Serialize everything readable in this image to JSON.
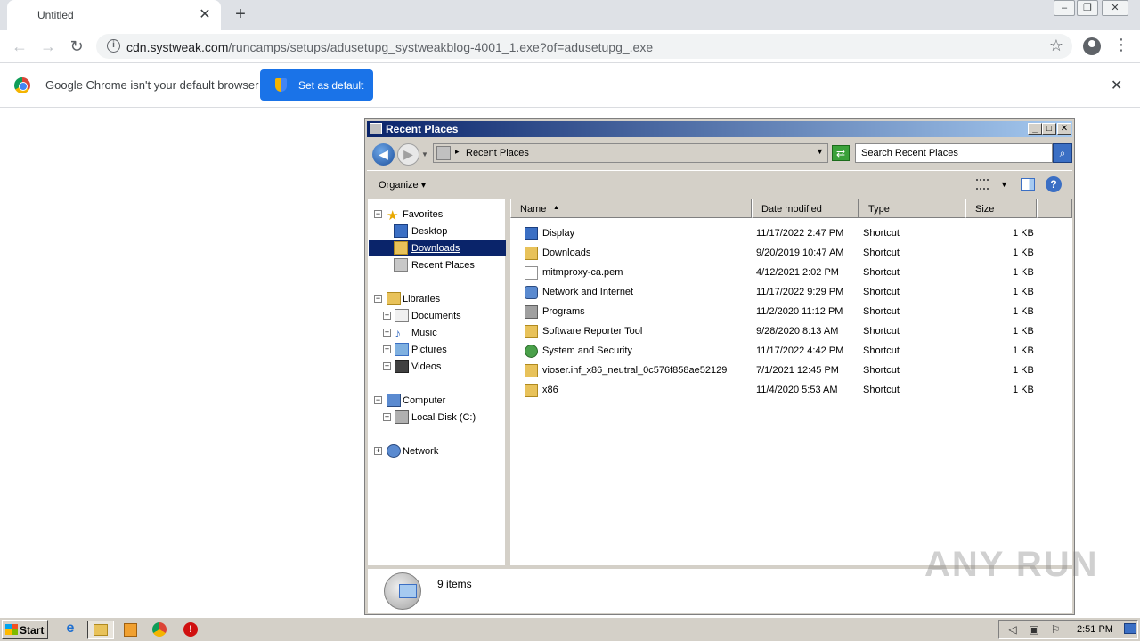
{
  "browser": {
    "tab_title": "Untitled",
    "tab_close": "✕",
    "new_tab": "+",
    "url_host": "cdn.systweak.com",
    "url_path": "/runcamps/setups/adusetupg_systweakblog-4001_1.exe?of=adusetupg_.exe",
    "info_text": "Google Chrome isn't your default browser",
    "set_default_label": "Set as default",
    "info_close": "✕",
    "back": "←",
    "forward": "→",
    "reload": "↻",
    "star": "☆",
    "menu": "⋮",
    "info_icon": "i"
  },
  "explorer": {
    "title": "Recent Places",
    "address_text": "Recent Places",
    "search_placeholder": "Search Recent Places",
    "organize_label": "Organize",
    "nav": {
      "favorites": "Favorites",
      "desktop": "Desktop",
      "downloads": "Downloads",
      "recent_places": "Recent Places",
      "libraries": "Libraries",
      "documents": "Documents",
      "music": "Music",
      "pictures": "Pictures",
      "videos": "Videos",
      "computer": "Computer",
      "local_disk": "Local Disk (C:)",
      "network": "Network"
    },
    "columns": {
      "name": "Name",
      "date_modified": "Date modified",
      "type": "Type",
      "size": "Size"
    },
    "files": [
      {
        "name": "Display",
        "date": "11/17/2022 2:47 PM",
        "type": "Shortcut",
        "size": "1 KB",
        "icon": "display-icon"
      },
      {
        "name": "Downloads",
        "date": "9/20/2019 10:47 AM",
        "type": "Shortcut",
        "size": "1 KB",
        "icon": "folder-icon"
      },
      {
        "name": "mitmproxy-ca.pem",
        "date": "4/12/2021 2:02 PM",
        "type": "Shortcut",
        "size": "1 KB",
        "icon": "file-icon"
      },
      {
        "name": "Network and Internet",
        "date": "11/17/2022 9:29 PM",
        "type": "Shortcut",
        "size": "1 KB",
        "icon": "network-icon"
      },
      {
        "name": "Programs",
        "date": "11/2/2020 11:12 PM",
        "type": "Shortcut",
        "size": "1 KB",
        "icon": "programs-icon"
      },
      {
        "name": "Software Reporter Tool",
        "date": "9/28/2020 8:13 AM",
        "type": "Shortcut",
        "size": "1 KB",
        "icon": "folder-icon"
      },
      {
        "name": "System and Security",
        "date": "11/17/2022 4:42 PM",
        "type": "Shortcut",
        "size": "1 KB",
        "icon": "security-icon"
      },
      {
        "name": "vioser.inf_x86_neutral_0c576f858ae52129",
        "date": "7/1/2021 12:45 PM",
        "type": "Shortcut",
        "size": "1 KB",
        "icon": "folder-icon"
      },
      {
        "name": "x86",
        "date": "11/4/2020 5:53 AM",
        "type": "Shortcut",
        "size": "1 KB",
        "icon": "folder-icon"
      }
    ],
    "item_count": "9 items"
  },
  "taskbar": {
    "start_label": "Start",
    "clock": "2:51 PM"
  },
  "watermark": "ANY RUN",
  "colors": {
    "chrome_blue": "#1a73e8",
    "titlebar_dark": "#0a246a",
    "titlebar_light": "#a6caf0",
    "classic_gray": "#d4d0c8",
    "selection": "#0a246a"
  }
}
